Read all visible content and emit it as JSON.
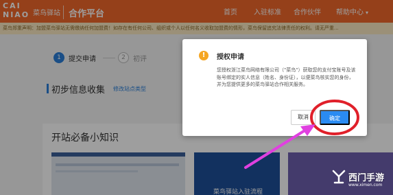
{
  "header": {
    "logo_line1": "CAI",
    "logo_line2": "NIAO",
    "logo_cn": "菜鸟驿站",
    "platform": "合作平台",
    "nav": {
      "home": "首页",
      "standard": "入驻标准",
      "partner": "合作伙伴",
      "help": "帮助中心"
    }
  },
  "notice": "菜鸟郑重声明：加盟菜鸟驿站无需缴纳任何加盟费！如存在有任何公司、组织或个人以任何名义收取加盟费的情形，菜鸟保留追究法律责任的权利。请无严重...",
  "steps": {
    "step1_num": "1",
    "step1_label": "提交申请",
    "step2_num": "2",
    "step2_label": "初评"
  },
  "section": {
    "title": "初步信息收集",
    "link": "修改站点类型"
  },
  "knowledge": {
    "title": "开站必备小知识",
    "video2_caption": "菜鸟驿站入驻流程"
  },
  "dialog": {
    "icon": "!",
    "title": "授权申请",
    "body": "您授权浙江菜鸟网络有限公司（\"菜鸟\"）获取您的支付宝账号及该账号绑定的实人信息（姓名、身份证），以便菜鸟核实您的身份，并为您提供更多的菜鸟驿站合作相关服务。",
    "cancel": "取消",
    "confirm": "确定"
  },
  "watermark": {
    "text": "西门手游",
    "url": "www.ximen.com"
  },
  "colors": {
    "brand": "#f0682a",
    "primary": "#2a8bf2",
    "warning": "#f5a623",
    "annotation": "#e0202a",
    "arrow": "#e040e0"
  }
}
